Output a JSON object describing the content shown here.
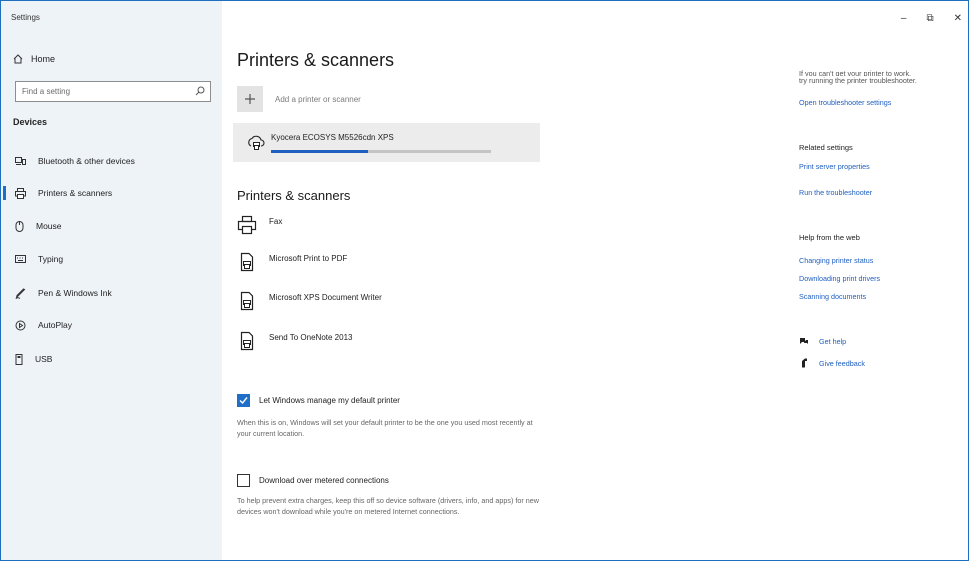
{
  "app": {
    "title": "Settings"
  },
  "window_controls": {
    "minimize": "–",
    "restore": "⧉",
    "close": "✕"
  },
  "sidebar": {
    "home_label": "Home",
    "search_placeholder": "Find a setting",
    "section_label": "Devices",
    "items": [
      {
        "label": "Bluetooth & other devices",
        "icon": "bluetooth-devices-icon",
        "active": false
      },
      {
        "label": "Printers & scanners",
        "icon": "printer-icon",
        "active": true
      },
      {
        "label": "Mouse",
        "icon": "mouse-icon",
        "active": false
      },
      {
        "label": "Typing",
        "icon": "keyboard-icon",
        "active": false
      },
      {
        "label": "Pen & Windows Ink",
        "icon": "pen-icon",
        "active": false
      },
      {
        "label": "AutoPlay",
        "icon": "autoplay-icon",
        "active": false
      },
      {
        "label": "USB",
        "icon": "usb-icon",
        "active": false
      }
    ]
  },
  "main": {
    "title": "Printers & scanners",
    "add_label": "Add a printer or scanner",
    "installing": {
      "name": "Kyocera ECOSYS M5526cdn XPS",
      "progress": 0.44
    },
    "list_title": "Printers & scanners",
    "devices": [
      {
        "name": "Fax",
        "icon": "fax-printer-icon"
      },
      {
        "name": "Microsoft Print to PDF",
        "icon": "document-printer-icon"
      },
      {
        "name": "Microsoft XPS Document Writer",
        "icon": "document-printer-icon"
      },
      {
        "name": "Send To OneNote 2013",
        "icon": "document-printer-icon"
      }
    ],
    "manage_default": {
      "label": "Let Windows manage my default printer",
      "checked": true,
      "desc": "When this is on, Windows will set your default printer to be the one you used most recently at your current location."
    },
    "metered": {
      "label": "Download over metered connections",
      "checked": false,
      "desc": "To help prevent extra charges, keep this off so device software (drivers, info, and apps) for new devices won't download while you're on metered Internet connections."
    }
  },
  "right": {
    "cut_text": "If you can't get your printer to work,",
    "troubleshoot_text": "try running the printer troubleshooter.",
    "troubleshoot_link": "Open troubleshooter settings",
    "related_heading": "Related settings",
    "related_links": [
      "Print server properties",
      "Run the troubleshooter"
    ],
    "web_heading": "Help from the web",
    "web_links": [
      "Changing printer status",
      "Downloading print drivers",
      "Scanning documents"
    ],
    "get_help": "Get help",
    "give_feedback": "Give feedback"
  },
  "colors": {
    "accent": "#1f6fc8",
    "link": "#1f5fbf",
    "sidebar_bg": "#eef3f8"
  }
}
